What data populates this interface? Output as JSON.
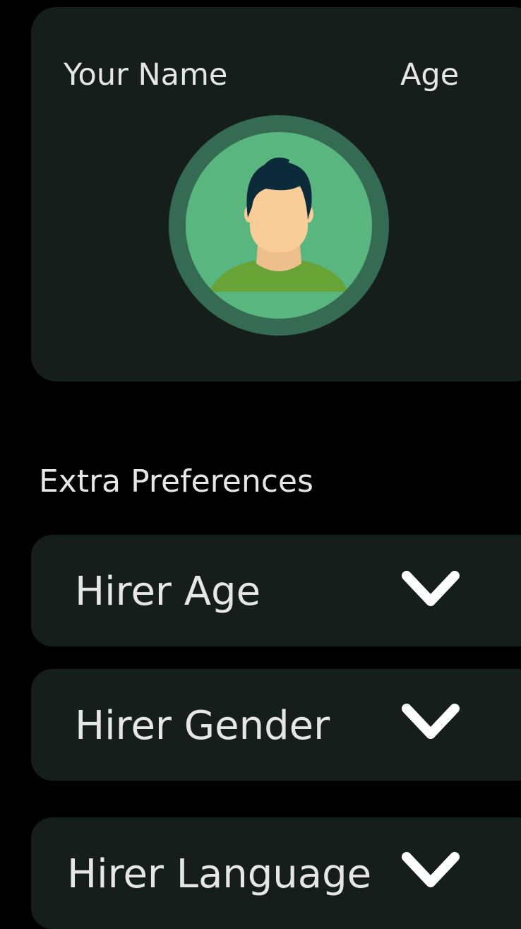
{
  "profile": {
    "name_label": "Your Name",
    "age_label": "Age"
  },
  "preferences": {
    "title": "Extra Preferences",
    "dropdowns": [
      {
        "label": "Hirer Age",
        "icon": "chevron-down-icon"
      },
      {
        "label": "Hirer Gender",
        "icon": "chevron-down-icon"
      },
      {
        "label": "Hirer Language",
        "icon": "chevron-down-icon"
      }
    ]
  },
  "colors": {
    "background": "#000000",
    "card": "#151e1a",
    "avatar_ring": "#356b52",
    "avatar_fill": "#5ab67f",
    "text": "#e6e6e6"
  }
}
